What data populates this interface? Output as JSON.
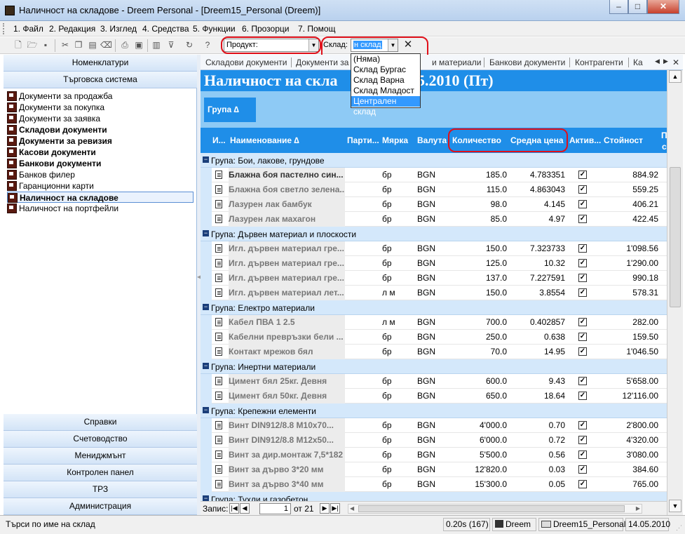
{
  "window": {
    "title": "Наличност на складове - Dreem Personal - [Dreem15_Personal (Dreem)]"
  },
  "menu": [
    "1. Файл",
    "2. Редакция",
    "3. Изглед",
    "4. Средства",
    "5. Функции",
    "6. Прозорци",
    "7. Помощ"
  ],
  "toolbar": {
    "product_value": "Продукт:",
    "warehouse_label": "Склад:",
    "warehouse_value": "н склад",
    "dropdown_options": [
      "(Няма)",
      "Склад Бургас",
      "Склад Варна",
      "Склад Младост",
      "Централен склад"
    ],
    "selected_option": "Централен склад"
  },
  "sidebar": {
    "top_headers": [
      "Номенклатури",
      "Търговска система"
    ],
    "items": [
      {
        "label": "Документи за продажба",
        "bold": false
      },
      {
        "label": "Документи за покупка",
        "bold": false
      },
      {
        "label": "Документи за заявка",
        "bold": false
      },
      {
        "label": "Складови документи",
        "bold": true
      },
      {
        "label": "Документи за ревизия",
        "bold": true
      },
      {
        "label": "Касови документи",
        "bold": true
      },
      {
        "label": "Банкови документи",
        "bold": true
      },
      {
        "label": "Банков филер",
        "bold": false
      },
      {
        "label": "Гаранционни карти",
        "bold": false
      },
      {
        "label": "Наличност на складове",
        "bold": true,
        "selected": true
      },
      {
        "label": "Наличност на портфейли",
        "bold": false
      }
    ],
    "bottom_headers": [
      "Справки",
      "Счетоводство",
      "Мениджмънт",
      "Контролен панел",
      "ТРЗ",
      "Администрация"
    ]
  },
  "tabs": [
    "Складови документи",
    "Документи за",
    "и материали",
    "Банкови документи",
    "Контрагенти",
    "Ка"
  ],
  "main_title": "Наличност на скла",
  "main_title_date": "5.2010 (Пт)",
  "group_button": "Група ∆",
  "columns": [
    "И...",
    "Наименование ∆",
    "Парти...",
    "Мярка",
    "Валута",
    "Количество",
    "Средна цена",
    "Актив...",
    "Стойност",
    "П",
    "с"
  ],
  "groups": [
    {
      "name": "Група: Бои, лакове, грундове",
      "rows": [
        [
          "Блажна боя пастелно син...",
          "бр",
          "BGN",
          "185.0",
          "4.783351",
          "884.92"
        ],
        [
          "Блажна боя светло зелена...",
          "бр",
          "BGN",
          "115.0",
          "4.863043",
          "559.25"
        ],
        [
          "Лазурен лак бамбук",
          "бр",
          "BGN",
          "98.0",
          "4.145",
          "406.21"
        ],
        [
          "Лазурен лак махагон",
          "бр",
          "BGN",
          "85.0",
          "4.97",
          "422.45"
        ]
      ]
    },
    {
      "name": "Група: Дървен материал и плоскости",
      "rows": [
        [
          "Игл. дървен материал гре...",
          "бр",
          "BGN",
          "150.0",
          "7.323733",
          "1'098.56"
        ],
        [
          "Игл. дървен материал гре...",
          "бр",
          "BGN",
          "125.0",
          "10.32",
          "1'290.00"
        ],
        [
          "Игл. дървен материал гре...",
          "бр",
          "BGN",
          "137.0",
          "7.227591",
          "990.18"
        ],
        [
          "Игл. дървен материал лет...",
          "л м",
          "BGN",
          "150.0",
          "3.8554",
          "578.31"
        ]
      ]
    },
    {
      "name": "Група: Електро материали",
      "rows": [
        [
          "Кабел ПВА 1 2.5",
          "л м",
          "BGN",
          "700.0",
          "0.402857",
          "282.00"
        ],
        [
          "Кабелни превръзки бели ...",
          "бр",
          "BGN",
          "250.0",
          "0.638",
          "159.50"
        ],
        [
          "Контакт мрежов бял",
          "бр",
          "BGN",
          "70.0",
          "14.95",
          "1'046.50"
        ]
      ]
    },
    {
      "name": "Група: Инертни материали",
      "rows": [
        [
          "Цимент бял 25кг. Девня",
          "бр",
          "BGN",
          "600.0",
          "9.43",
          "5'658.00"
        ],
        [
          "Цимент бял 50кг. Девня",
          "бр",
          "BGN",
          "650.0",
          "18.64",
          "12'116.00"
        ]
      ]
    },
    {
      "name": "Група: Крепежни елементи",
      "rows": [
        [
          "Винт DIN912/8.8 M10x70...",
          "бр",
          "BGN",
          "4'000.0",
          "0.70",
          "2'800.00"
        ],
        [
          "Винт DIN912/8.8 M12x50...",
          "бр",
          "BGN",
          "6'000.0",
          "0.72",
          "4'320.00"
        ],
        [
          "Винт за дир.монтаж 7,5*182",
          "бр",
          "BGN",
          "5'500.0",
          "0.56",
          "3'080.00"
        ],
        [
          "Винт за дърво 3*20 мм",
          "бр",
          "BGN",
          "12'820.0",
          "0.03",
          "384.60"
        ],
        [
          "Винт за дърво 3*40 мм",
          "бр",
          "BGN",
          "15'300.0",
          "0.05",
          "765.00"
        ]
      ]
    },
    {
      "name": "Група: Тухли и газобетон",
      "rows": []
    }
  ],
  "navigator": {
    "label": "Запис:",
    "current": "1",
    "total": "от 21"
  },
  "status": {
    "hint": "Търси по име на склад",
    "timing": "0.20s (167)",
    "user": "Dreem",
    "db": "Dreem15_Personal",
    "date": "14.05.2010"
  }
}
